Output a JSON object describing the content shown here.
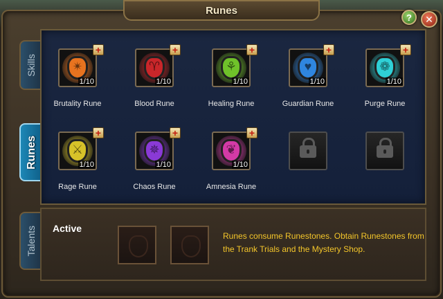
{
  "window": {
    "title": "Runes",
    "help_label": "?",
    "close_label": "✕"
  },
  "tabs": [
    {
      "label": "Skills",
      "active": false
    },
    {
      "label": "Runes",
      "active": true
    },
    {
      "label": "Talents",
      "active": false
    }
  ],
  "runes": [
    {
      "name": "Brutality Rune",
      "count": "1/10",
      "color": "#e8731f",
      "symbol": "✴",
      "icon": "brutality-rune-icon"
    },
    {
      "name": "Blood Rune",
      "count": "1/10",
      "color": "#c9262a",
      "symbol": "♈",
      "icon": "blood-rune-icon"
    },
    {
      "name": "Healing Rune",
      "count": "1/10",
      "color": "#6fc22a",
      "symbol": "⚘",
      "icon": "healing-rune-icon"
    },
    {
      "name": "Guardian Rune",
      "count": "1/10",
      "color": "#2f86e0",
      "symbol": "♥",
      "icon": "guardian-rune-icon"
    },
    {
      "name": "Purge Rune",
      "count": "1/10",
      "color": "#2fd0d6",
      "symbol": "❁",
      "icon": "purge-rune-icon"
    },
    {
      "name": "Rage Rune",
      "count": "1/10",
      "color": "#d7c229",
      "symbol": "⚔",
      "icon": "rage-rune-icon"
    },
    {
      "name": "Chaos Rune",
      "count": "1/10",
      "color": "#8a3ad6",
      "symbol": "✵",
      "icon": "chaos-rune-icon"
    },
    {
      "name": "Amnesia Rune",
      "count": "1/10",
      "color": "#d33aa6",
      "symbol": "❦",
      "icon": "amnesia-rune-icon"
    }
  ],
  "locked_slots": 2,
  "plus_label": "+",
  "active_section": {
    "label": "Active",
    "slots": 2,
    "info": "Runes consume Runestones. Obtain Runestones from the Trank Trials and the Mystery Shop."
  }
}
